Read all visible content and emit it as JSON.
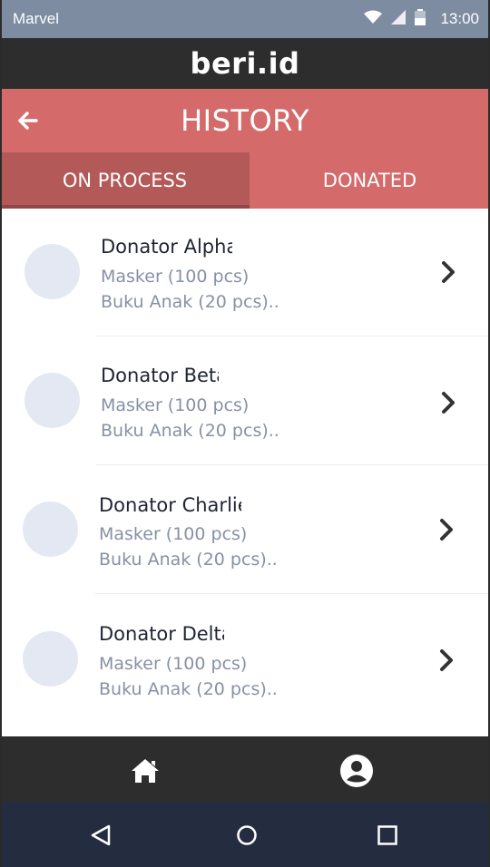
{
  "status_bar": {
    "carrier": "Marvel",
    "time": "13:00",
    "icons": [
      "wifi-icon",
      "signal-icon",
      "battery-icon"
    ]
  },
  "app": {
    "logo": "beri.id"
  },
  "history": {
    "title": "HISTORY",
    "back_icon": "arrow-left-icon"
  },
  "tabs": [
    {
      "label": "ON PROCESS",
      "active": true
    },
    {
      "label": "DONATED",
      "active": false
    }
  ],
  "items": [
    {
      "name": "Donator Alpha",
      "line1": "Masker (100 pcs)",
      "line2": "Buku Anak (20 pcs).."
    },
    {
      "name": "Donator Beta",
      "line1": "Masker (100 pcs)",
      "line2": "Buku Anak (20 pcs).."
    },
    {
      "name": "Donator Charlie",
      "line1": "Masker (100 pcs)",
      "line2": "Buku Anak (20 pcs).."
    },
    {
      "name": "Donator Delta",
      "line1": "Masker (100 pcs)",
      "line2": "Buku Anak (20 pcs).."
    }
  ],
  "bottom_nav": {
    "items": [
      "home-icon",
      "profile-icon"
    ]
  },
  "system_nav": {
    "items": [
      "back-triangle-icon",
      "home-circle-icon",
      "recents-square-icon"
    ]
  },
  "colors": {
    "accent": "#d46a6a",
    "tab_active": "#b35a59",
    "dark_bar": "#2d2d2d",
    "status_bar": "#7d8ca0",
    "system_nav": "#242d40",
    "avatar": "#e4e8f2"
  }
}
